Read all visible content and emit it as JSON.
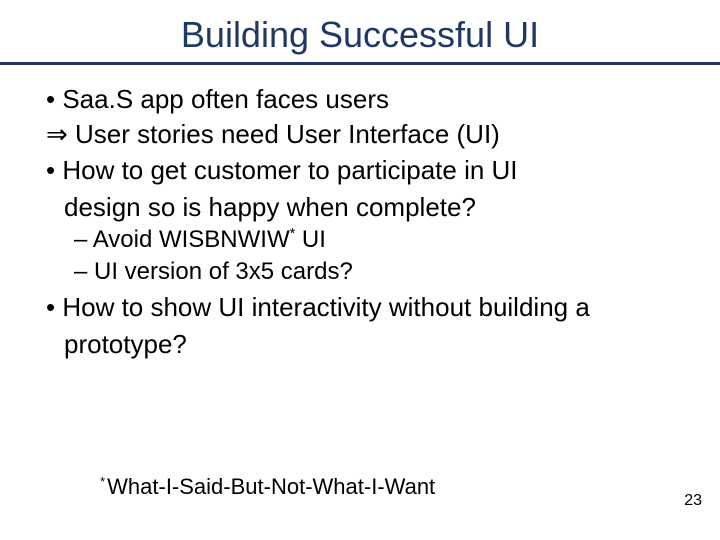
{
  "title": "Building Successful UI",
  "bullets": {
    "line1": "Saa.S app often faces users",
    "line2_prefix": "⇒",
    "line2": "User stories need User Interface (UI)",
    "line3a": "How to get customer to participate in UI",
    "line3b": "design so is happy when complete?",
    "sub1_prefix": "Avoid WISBNWIW",
    "sub1_suffix": " UI",
    "sub2": "UI version of 3x5 cards?",
    "line4a": "How to show UI interactivity without building a",
    "line4b": "prototype?"
  },
  "footnote": "What-I-Said-But-Not-What-I-Want",
  "asterisk": "*",
  "page_number": "23"
}
